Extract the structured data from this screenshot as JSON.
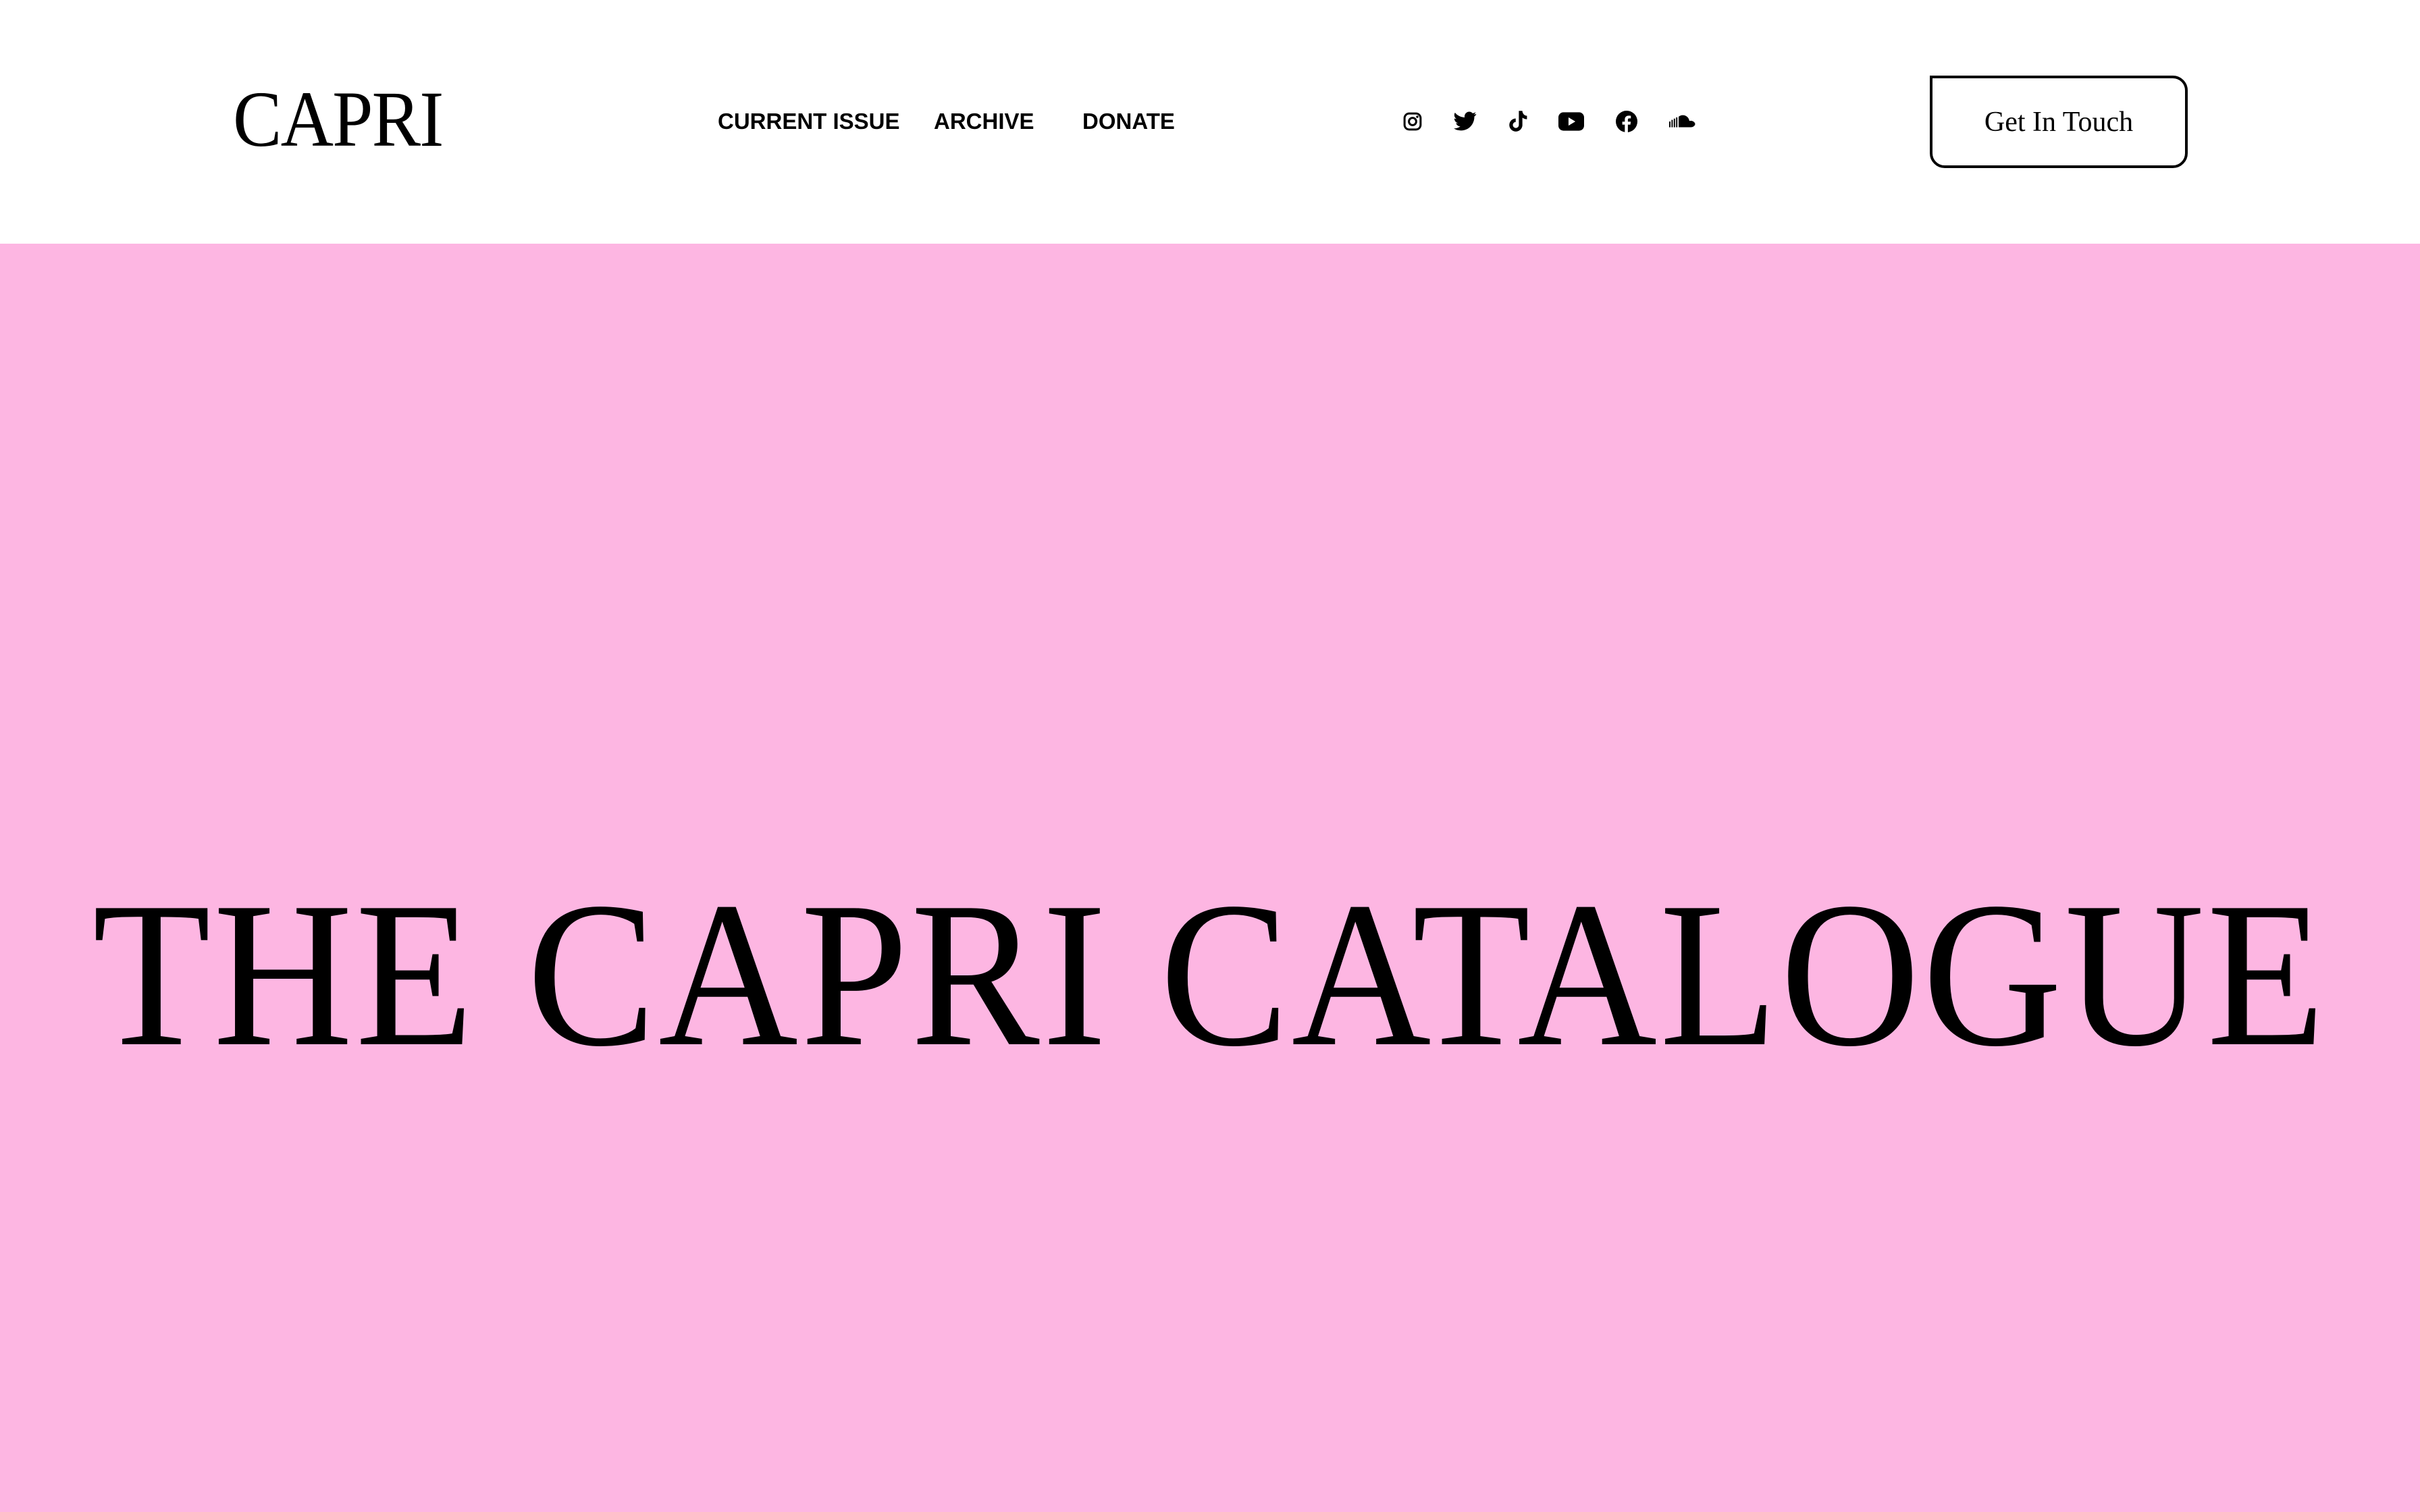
{
  "header": {
    "logo": "CAPRI",
    "nav": [
      {
        "label": "CURRENT ISSUE"
      },
      {
        "label": "ARCHIVE"
      },
      {
        "label": "DONATE"
      }
    ],
    "social_icons": [
      "instagram-icon",
      "twitter-icon",
      "tiktok-icon",
      "youtube-icon",
      "facebook-icon",
      "soundcloud-icon"
    ],
    "cta_label": "Get In Touch"
  },
  "hero": {
    "title": "THE CAPRI CATALOGUE"
  },
  "colors": {
    "hero_background": "#fdb6e2",
    "header_background": "#ffffff",
    "text": "#000000"
  }
}
